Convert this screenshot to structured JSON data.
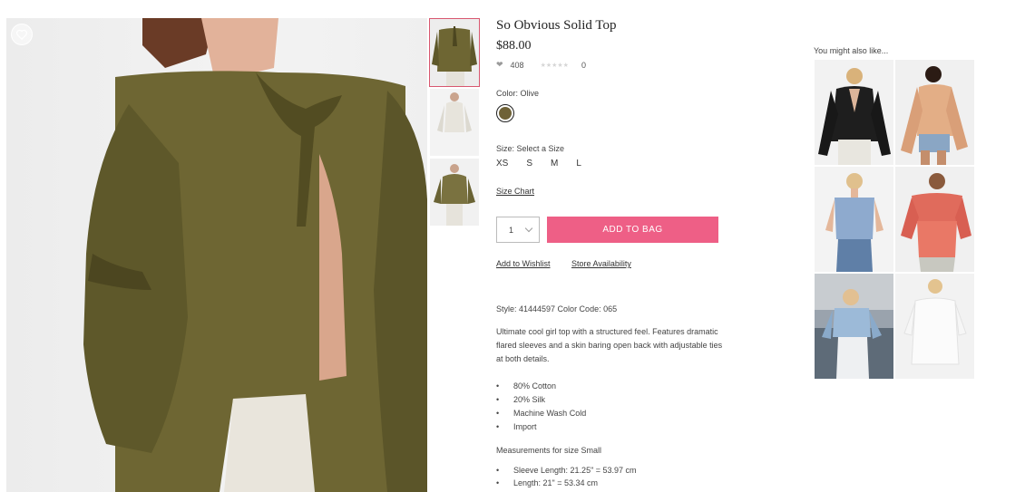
{
  "product": {
    "title": "So Obvious Solid Top",
    "price": "$88.00",
    "favorites_count": "408",
    "review_count": "0",
    "color_label": "Color: Olive",
    "color_hex": "#6f6237",
    "size_label": "Size: Select a Size",
    "sizes": [
      "XS",
      "S",
      "M",
      "L"
    ],
    "size_chart_link": "Size Chart",
    "quantity": "1",
    "add_to_bag": "ADD TO BAG",
    "add_to_wishlist": "Add to Wishlist",
    "store_availability": "Store Availability",
    "style_line": "Style: 41444597 Color Code: 065",
    "description": "Ultimate cool girl top with a structured feel. Features dramatic flared sleeves and a skin baring open back with adjustable ties at both details.",
    "features": [
      "80% Cotton",
      "20% Silk",
      "Machine Wash Cold",
      "Import"
    ],
    "measurements_label": "Measurements for size Small",
    "measurements": [
      "Sleeve Length: 21.25\" = 53.97 cm",
      "Length: 21\" = 53.34 cm"
    ]
  },
  "recommendations": {
    "title": "You might also like..."
  },
  "icons": {
    "favorite": "heart-outline-icon",
    "rating": "star-icon",
    "quantity_dropdown": "chevron-down-icon"
  },
  "colors": {
    "accent": "#ee5f86",
    "olive": "#6f6237"
  }
}
